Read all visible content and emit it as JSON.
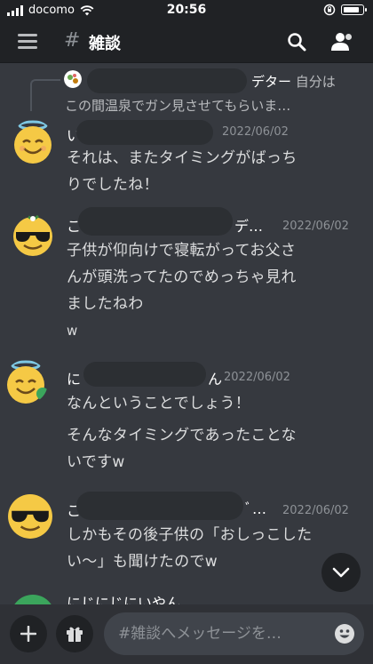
{
  "status_bar": {
    "carrier": "docomo",
    "time": "20:56"
  },
  "header": {
    "hash_symbol": "#",
    "channel_name": "雑談"
  },
  "reply": {
    "author_tail": "デター",
    "line1_suffix": "自分は",
    "line2": "この間温泉でガン見させてもらいま…"
  },
  "messages": [
    {
      "author_visible": "い",
      "timestamp": "2022/06/02",
      "lines": [
        "それは、またタイミングがばっち",
        "りでしたね！"
      ]
    },
    {
      "author_visible": "こ",
      "author_tail": "デ…",
      "timestamp": "2022/06/02",
      "lines": [
        "子供が仰向けで寝転がってお父さ",
        "んが頭洗ってたのでめっちゃ見れ",
        "ましたねわ",
        "w"
      ]
    },
    {
      "author_visible": "に",
      "author_tail": "ん",
      "timestamp": "2022/06/02",
      "lines": [
        "なんということでしょう！"
      ],
      "lines2": [
        "そんなタイミングであったことな",
        "いですw"
      ]
    },
    {
      "author_visible": "こ",
      "author_tail": "ﾞ…",
      "timestamp": "2022/06/02",
      "lines": [
        "しかもその後子供の「おしっこした",
        "い〜」も聞けたのでw"
      ]
    },
    {
      "author_visible": "にじにじにいやん"
    }
  ],
  "composer": {
    "placeholder": "#雑談へメッセージを…"
  },
  "colors": {
    "background": "#36393f",
    "header": "#202225",
    "composer": "#2f3136",
    "input": "#40444b"
  }
}
